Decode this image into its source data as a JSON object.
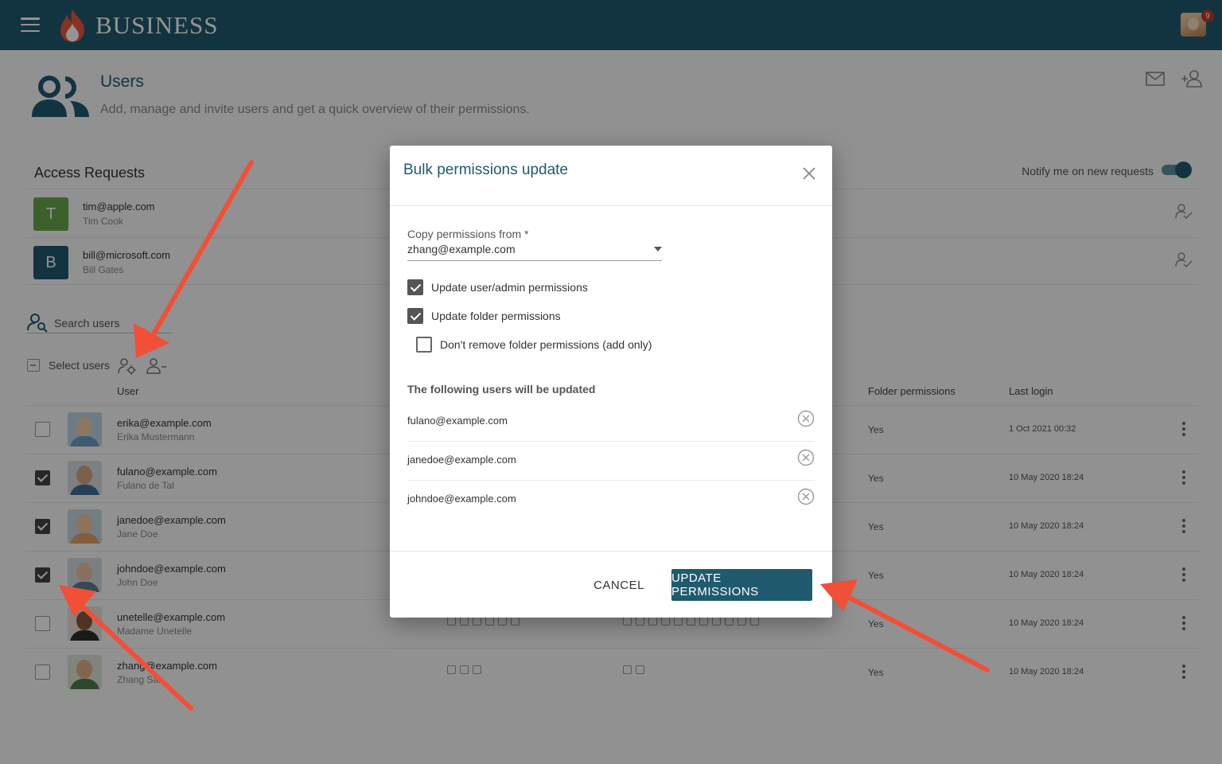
{
  "topbar": {
    "brand": "BUSINESS",
    "notification_count": "9",
    "icons": {
      "menu": "hamburger-menu-icon",
      "logo": "flame-logo",
      "profile": "profile-avatar"
    }
  },
  "header": {
    "title": "Users",
    "subtitle": "Add, manage and invite users and get a quick overview of their permissions.",
    "icons": {
      "page": "users-icon",
      "mail": "mail-icon",
      "add_user": "add-user-icon"
    }
  },
  "access_requests": {
    "title": "Access Requests",
    "notify_label": "Notify me on new requests",
    "notify_enabled": true,
    "items": [
      {
        "initial": "T",
        "email": "tim@apple.com",
        "name": "Tim Cook",
        "color": "#6aa84f"
      },
      {
        "initial": "B",
        "email": "bill@microsoft.com",
        "name": "Bill Gates",
        "color": "#1f5a6e"
      }
    ]
  },
  "search": {
    "label": "Search users"
  },
  "selection": {
    "label": "Select users"
  },
  "table": {
    "columns": {
      "user": "User",
      "folder_permissions": "Folder permissions",
      "last_login": "Last login"
    },
    "rows": [
      {
        "checked": false,
        "email": "erika@example.com",
        "name": "Erika Mustermann",
        "folder": "Yes",
        "last_login": "1 Oct 2021 00:32"
      },
      {
        "checked": true,
        "email": "fulano@example.com",
        "name": "Fulano de Tal",
        "folder": "Yes",
        "last_login": "10 May 2020 18:24"
      },
      {
        "checked": true,
        "email": "janedoe@example.com",
        "name": "Jane Doe",
        "folder": "Yes",
        "last_login": "10 May 2020 18:24"
      },
      {
        "checked": true,
        "email": "johndoe@example.com",
        "name": "John Doe",
        "folder": "Yes",
        "last_login": "10 May 2020 18:24"
      },
      {
        "checked": false,
        "email": "unetelle@example.com",
        "name": "Madame Unetelle",
        "folder": "Yes",
        "last_login": "10 May 2020 18:24"
      },
      {
        "checked": false,
        "email": "zhang@example.com",
        "name": "Zhang San",
        "folder": "Yes",
        "last_login": "10 May 2020 18:24"
      }
    ]
  },
  "dialog": {
    "title": "Bulk permissions update",
    "copy_from_label": "Copy permissions from *",
    "copy_from_value": "zhang@example.com",
    "options": [
      {
        "label": "Update user/admin permissions",
        "checked": true
      },
      {
        "label": "Update folder permissions",
        "checked": true
      },
      {
        "label": "Don't remove folder permissions (add only)",
        "checked": false
      }
    ],
    "list_heading": "The following users will be updated",
    "users": [
      "fulano@example.com",
      "janedoe@example.com",
      "johndoe@example.com"
    ],
    "cancel_label": "CANCEL",
    "submit_label": "UPDATE PERMISSIONS"
  },
  "colors": {
    "primary": "#1f5a6e",
    "arrow": "#f24f37",
    "badge": "#c0392b"
  }
}
